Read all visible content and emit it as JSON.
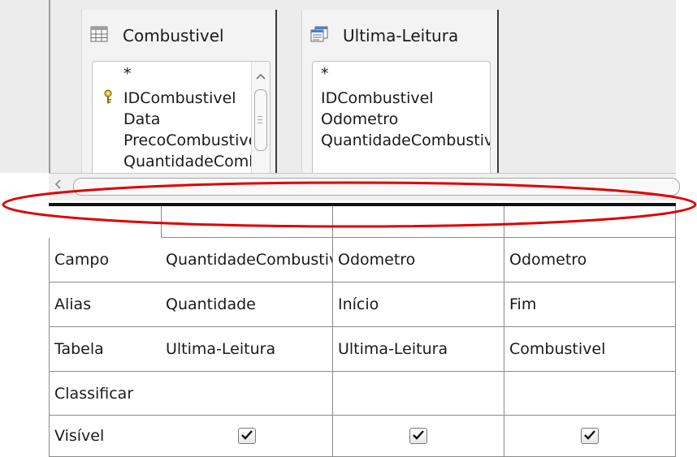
{
  "tables": [
    {
      "title": "Combustivel",
      "fields": [
        "*",
        "IDCombustivel",
        "Data",
        "PrecoCombustivel",
        "QuantidadeCombustivel"
      ],
      "primary_key": "IDCombustivel"
    },
    {
      "title": "Ultima-Leitura",
      "fields": [
        "*",
        "IDCombustivel",
        "Odometro",
        "QuantidadeCombustivel"
      ]
    }
  ],
  "grid": {
    "row_headers": [
      "Campo",
      "Alias",
      "Tabela",
      "Classificar",
      "Visível"
    ],
    "columns": [
      {
        "campo": "QuantidadeCombustivel",
        "alias": "Quantidade",
        "tabela": "Ultima-Leitura",
        "classificar": "",
        "visivel": true
      },
      {
        "campo": "Odometro",
        "alias": "Início",
        "tabela": "Ultima-Leitura",
        "classificar": "",
        "visivel": true
      },
      {
        "campo": "Odometro",
        "alias": "Fim",
        "tabela": "Combustivel",
        "classificar": "",
        "visivel": true
      }
    ]
  },
  "annotation_color": "#e00000",
  "icons": [
    "table-icon",
    "query-icon",
    "key-icon",
    "scroll-up-icon",
    "scroll-left-icon",
    "checkbox-checked-icon"
  ]
}
